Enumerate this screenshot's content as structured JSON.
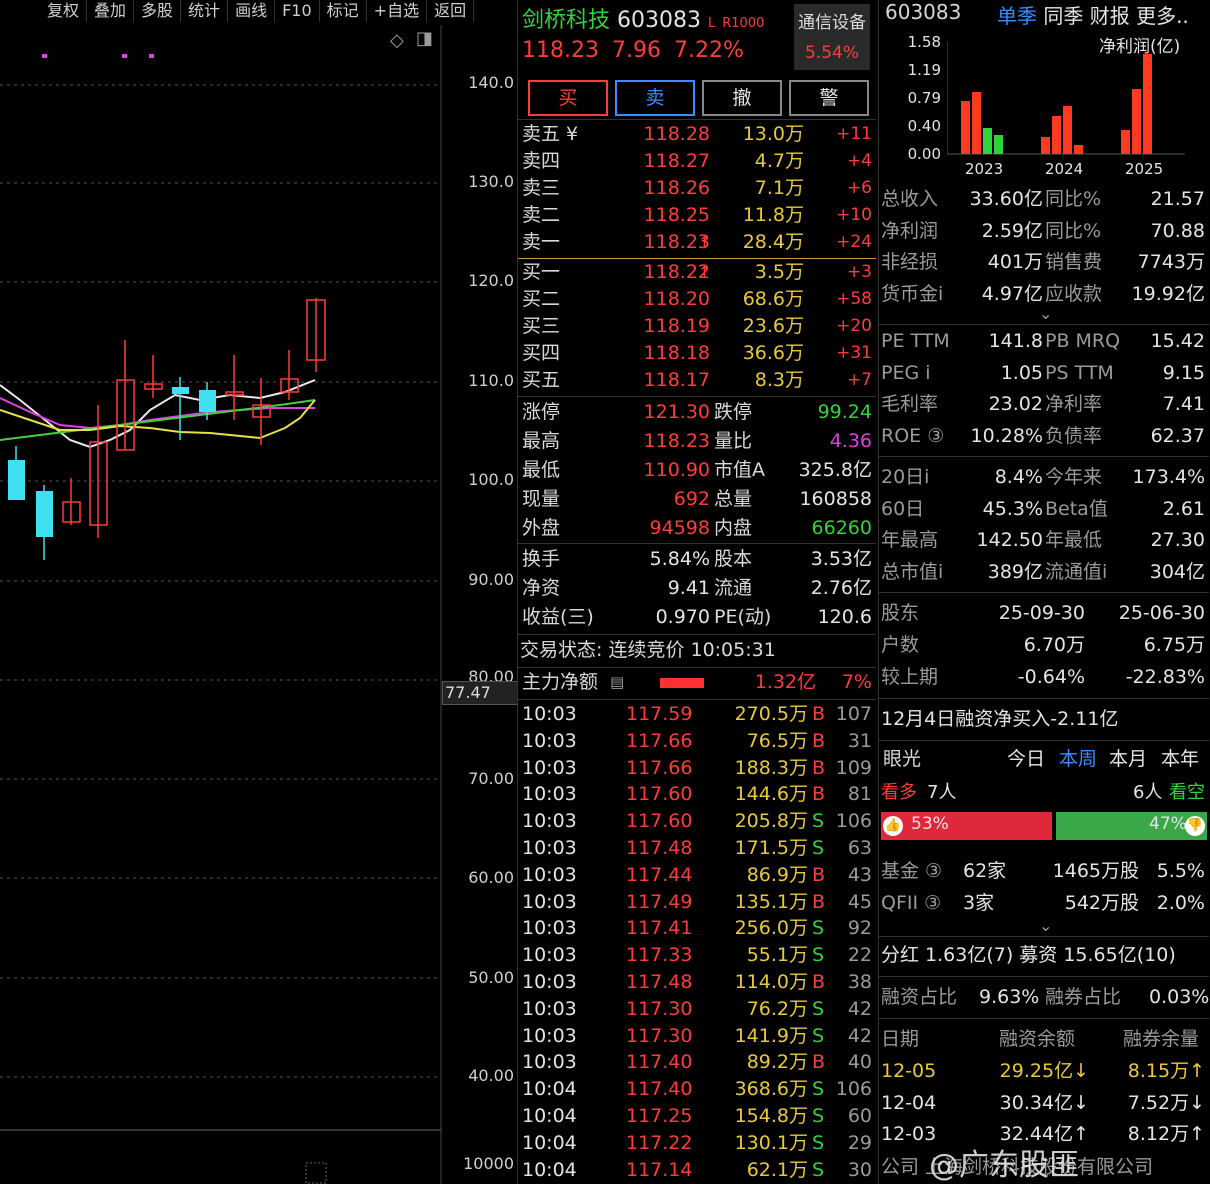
{
  "toolbar": [
    "复权",
    "叠加",
    "多股",
    "统计",
    "画线",
    "F10",
    "标记",
    "+自选",
    "返回"
  ],
  "y_axis": [
    "140.0",
    "130.0",
    "120.0",
    "110.0",
    "100.0",
    "90.00",
    "80.00",
    "70.00",
    "60.00",
    "50.00",
    "40.00",
    "10000"
  ],
  "last_price_tag": "77.47",
  "header": {
    "name": "剑桥科技",
    "code": "603083",
    "badge": "L",
    "badge2": "R1000",
    "sector": "通信设备",
    "sector_pct": "5.54%",
    "price": "118.23",
    "change": "7.96",
    "change_pct": "7.22%"
  },
  "buttons": [
    "买",
    "卖",
    "撤",
    "警"
  ],
  "asks": [
    {
      "label": "卖五 ¥",
      "price": "118.28",
      "vol": "13.0万",
      "chg": "+11"
    },
    {
      "label": "卖四",
      "price": "118.27",
      "vol": "4.7万",
      "chg": "+4"
    },
    {
      "label": "卖三",
      "price": "118.26",
      "vol": "7.1万",
      "chg": "+6"
    },
    {
      "label": "卖二",
      "price": "118.25",
      "vol": "11.8万",
      "chg": "+10"
    },
    {
      "label": "卖一",
      "price": "118.23",
      "vol": "28.4万",
      "chg": "+24"
    }
  ],
  "bids": [
    {
      "label": "买一",
      "price": "118.22",
      "vol": "3.5万",
      "chg": "+3"
    },
    {
      "label": "买二",
      "price": "118.20",
      "vol": "68.6万",
      "chg": "+58"
    },
    {
      "label": "买三",
      "price": "118.19",
      "vol": "23.6万",
      "chg": "+20"
    },
    {
      "label": "买四",
      "price": "118.18",
      "vol": "36.6万",
      "chg": "+31"
    },
    {
      "label": "买五",
      "price": "118.17",
      "vol": "8.3万",
      "chg": "+7"
    }
  ],
  "stats": [
    {
      "l1": "涨停",
      "v1": "121.30",
      "l2": "跌停",
      "v2": "99.24"
    },
    {
      "l1": "最高",
      "v1": "118.23",
      "l2": "量比",
      "v2": "4.36"
    },
    {
      "l1": "最低",
      "v1": "110.90",
      "l2": "市值A",
      "v2": "325.8亿"
    },
    {
      "l1": "现量",
      "v1": "692",
      "l2": "总量",
      "v2": "160858"
    },
    {
      "l1": "外盘",
      "v1": "94598",
      "l2": "内盘",
      "v2": "66260"
    }
  ],
  "stats2": [
    {
      "l1": "换手",
      "v1": "5.84%",
      "l2": "股本",
      "v2": "3.53亿"
    },
    {
      "l1": "净资",
      "v1": "9.41",
      "l2": "流通",
      "v2": "2.76亿"
    },
    {
      "l1": "收益(三)",
      "v1": "0.970",
      "l2": "PE(动)",
      "v2": "120.6"
    }
  ],
  "trade_status": "交易状态: 连续竞价 10:05:31",
  "main_flow": {
    "label": "主力净额",
    "value": "1.32亿",
    "pct": "7%"
  },
  "ticks": [
    {
      "t": "10:03",
      "p": "117.59",
      "v": "270.5万",
      "s": "B",
      "n": "107"
    },
    {
      "t": "10:03",
      "p": "117.66",
      "v": "76.5万",
      "s": "B",
      "n": "31"
    },
    {
      "t": "10:03",
      "p": "117.66",
      "v": "188.3万",
      "s": "B",
      "n": "109"
    },
    {
      "t": "10:03",
      "p": "117.60",
      "v": "144.6万",
      "s": "B",
      "n": "81"
    },
    {
      "t": "10:03",
      "p": "117.60",
      "v": "205.8万",
      "s": "S",
      "n": "106"
    },
    {
      "t": "10:03",
      "p": "117.48",
      "v": "171.5万",
      "s": "S",
      "n": "63"
    },
    {
      "t": "10:03",
      "p": "117.44",
      "v": "86.9万",
      "s": "B",
      "n": "43"
    },
    {
      "t": "10:03",
      "p": "117.49",
      "v": "135.1万",
      "s": "B",
      "n": "45"
    },
    {
      "t": "10:03",
      "p": "117.41",
      "v": "256.0万",
      "s": "S",
      "n": "92"
    },
    {
      "t": "10:03",
      "p": "117.33",
      "v": "55.1万",
      "s": "S",
      "n": "22"
    },
    {
      "t": "10:03",
      "p": "117.48",
      "v": "114.0万",
      "s": "B",
      "n": "38"
    },
    {
      "t": "10:03",
      "p": "117.30",
      "v": "76.2万",
      "s": "S",
      "n": "42"
    },
    {
      "t": "10:03",
      "p": "117.30",
      "v": "141.9万",
      "s": "S",
      "n": "42"
    },
    {
      "t": "10:03",
      "p": "117.40",
      "v": "89.2万",
      "s": "B",
      "n": "40"
    },
    {
      "t": "10:04",
      "p": "117.40",
      "v": "368.6万",
      "s": "S",
      "n": "106"
    },
    {
      "t": "10:04",
      "p": "117.25",
      "v": "154.8万",
      "s": "S",
      "n": "60"
    },
    {
      "t": "10:04",
      "p": "117.22",
      "v": "130.1万",
      "s": "S",
      "n": "29"
    },
    {
      "t": "10:04",
      "p": "117.14",
      "v": "62.1万",
      "s": "S",
      "n": "30"
    }
  ],
  "f10": {
    "code": "603083",
    "tabs": [
      "单季",
      "同季",
      "财报",
      "更多.."
    ],
    "chart_title": "净利润(亿)",
    "chart_y": [
      "1.58",
      "1.19",
      "0.79",
      "0.40",
      "0.00"
    ],
    "chart_years": [
      "2023",
      "2024",
      "2025"
    ],
    "fin": [
      {
        "l1": "总收入",
        "v1": "33.60亿",
        "l2": "同比%",
        "v2": "21.57"
      },
      {
        "l1": "净利润",
        "v1": "2.59亿",
        "l2": "同比%",
        "v2": "70.88"
      },
      {
        "l1": "非经损",
        "v1": "401万",
        "l2": "销售费",
        "v2": "7743万"
      },
      {
        "l1": "货币金i",
        "v1": "4.97亿",
        "l2": "应收款",
        "v2": "19.92亿"
      }
    ],
    "val": [
      {
        "l1": "PE TTM",
        "v1": "141.8",
        "l2": "PB MRQ",
        "v2": "15.42"
      },
      {
        "l1": "PEG i",
        "v1": "1.05",
        "l2": "PS TTM",
        "v2": "9.15"
      },
      {
        "l1": "毛利率",
        "v1": "23.02",
        "l2": "净利率",
        "v2": "7.41"
      },
      {
        "l1": "ROE ③",
        "v1": "10.28%",
        "l2": "负债率",
        "v2": "62.37"
      }
    ],
    "perf": [
      {
        "l1": "20日i",
        "v1": "8.4%",
        "l2": "今年来",
        "v2": "173.4%"
      },
      {
        "l1": "60日",
        "v1": "45.3%",
        "l2": "Beta值",
        "v2": "2.61"
      },
      {
        "l1": "年最高",
        "v1": "142.50",
        "l2": "年最低",
        "v2": "27.30"
      },
      {
        "l1": "总市值i",
        "v1": "389亿",
        "l2": "流通值i",
        "v2": "304亿"
      }
    ],
    "holders_hdr": {
      "l": "股东",
      "d1": "25-09-30",
      "d2": "25-06-30"
    },
    "holders": [
      {
        "l": "户数",
        "v1": "6.70万",
        "v2": "6.75万"
      },
      {
        "l": "较上期",
        "v1": "-0.64%",
        "v2": "-22.83%"
      }
    ],
    "margin_note": "12月4日融资净买入-2.11亿",
    "vision": {
      "label": "眼光",
      "tabs": [
        "今日",
        "本周",
        "本月",
        "本年"
      ],
      "bull": "看多",
      "bull_n": "7人",
      "bear_n": "6人",
      "bear": "看空",
      "bull_pct": "53%",
      "bear_pct": "47%",
      "bull_frac": 0.53
    },
    "funds": [
      {
        "l": "基金 ③",
        "n": "62家",
        "s": "1465万股",
        "p": "5.5%"
      },
      {
        "l": "QFII ③",
        "n": "3家",
        "s": "542万股",
        "p": "2.0%"
      }
    ],
    "dividend": "分红 1.63亿(7) 募资 15.65亿(10)",
    "margin_ratio": {
      "l1": "融资占比",
      "v1": "9.63%",
      "l2": "融券占比",
      "v2": "0.03%"
    },
    "margin_hdr": [
      "日期",
      "融资余额",
      "融券余量"
    ],
    "margin_rows": [
      {
        "d": "12-05",
        "a": "29.25亿↓",
        "b": "8.15万↑"
      },
      {
        "d": "12-04",
        "a": "30.34亿↓",
        "b": "7.52万↓"
      },
      {
        "d": "12-03",
        "a": "32.44亿↑",
        "b": "8.12万↑"
      }
    ],
    "company": "公司 上海剑桥科技股份有限公司"
  },
  "watermark": "@广东股匪"
}
